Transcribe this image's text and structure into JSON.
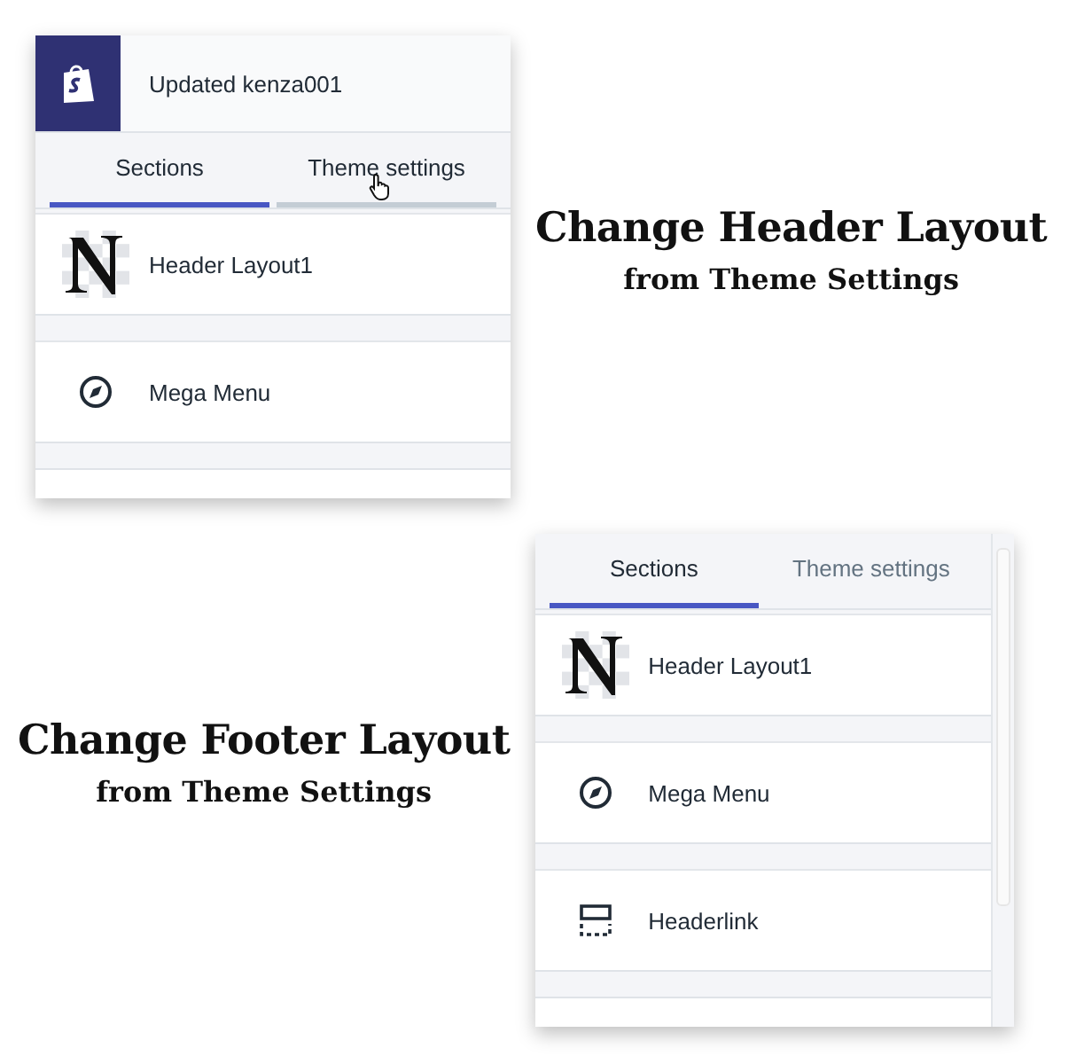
{
  "blocks": [
    {
      "panel": {
        "store_name": "Updated kenza001",
        "tabs": [
          {
            "label": "Sections",
            "selected": true,
            "hovered": false
          },
          {
            "label": "Theme settings",
            "selected": false,
            "hovered": true
          }
        ],
        "items": [
          {
            "kind": "logo",
            "label": "Header Layout1"
          },
          {
            "kind": "compass",
            "label": "Mega Menu"
          }
        ],
        "scrollbar": false
      },
      "caption": {
        "title": "Change Header Layout",
        "subtitle": "from Theme Settings"
      }
    },
    {
      "panel": {
        "tabs": [
          {
            "label": "Sections",
            "selected": true,
            "hovered": false
          },
          {
            "label": "Theme settings",
            "selected": false,
            "hovered": false
          }
        ],
        "items": [
          {
            "kind": "logo",
            "label": "Header Layout1"
          },
          {
            "kind": "compass",
            "label": "Mega Menu"
          },
          {
            "kind": "header",
            "label": "Headerlink"
          }
        ],
        "scrollbar": true
      },
      "caption": {
        "title": "Change Footer Layout",
        "subtitle": "from Theme Settings"
      }
    }
  ]
}
